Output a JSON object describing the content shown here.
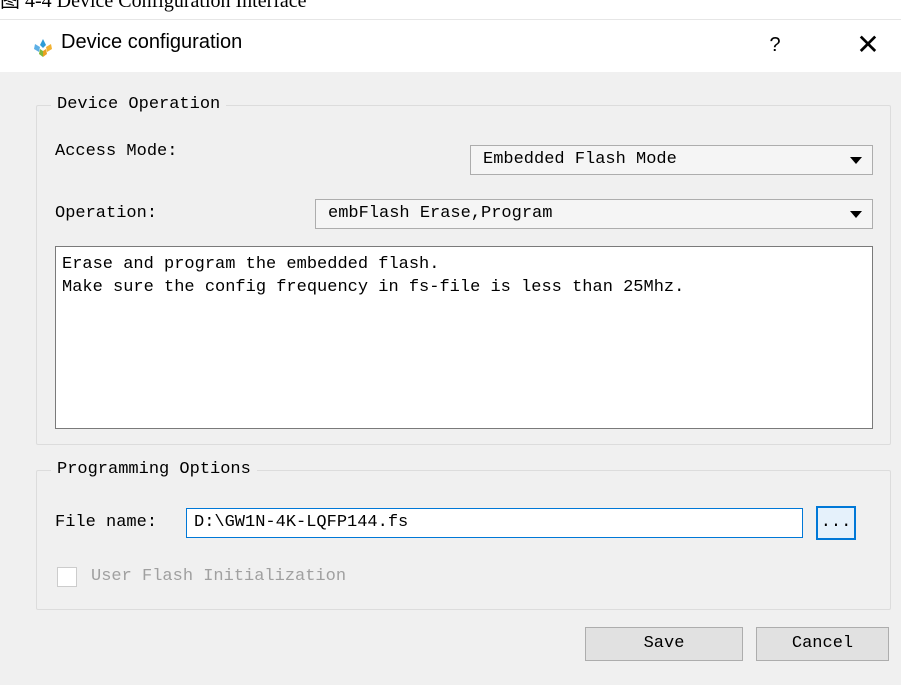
{
  "caption": "图 4-4 Device Configuration Interface",
  "window": {
    "title": "Device configuration",
    "help_label": "?",
    "close_label": "✕",
    "icon": "gowin-logo-icon"
  },
  "device_operation": {
    "group_title": "Device Operation",
    "access_mode_label": "Access Mode:",
    "access_mode_value": "Embedded Flash Mode",
    "operation_label": "Operation:",
    "operation_value": "embFlash Erase,Program",
    "description_lines": [
      "Erase and program the embedded flash.",
      "Make sure the config frequency in fs-file is less than 25Mhz."
    ]
  },
  "programming_options": {
    "group_title": "Programming Options",
    "file_name_label": "File name:",
    "file_name_value": "D:\\GW1N-4K-LQFP144.fs",
    "browse_label": "...",
    "user_flash_label": "User Flash Initialization",
    "user_flash_checked": false
  },
  "buttons": {
    "save": "Save",
    "cancel": "Cancel"
  },
  "colors": {
    "dialog_bg": "#f0f0f0",
    "focus_border": "#0078d7",
    "disabled_text": "#a0a0a0"
  }
}
